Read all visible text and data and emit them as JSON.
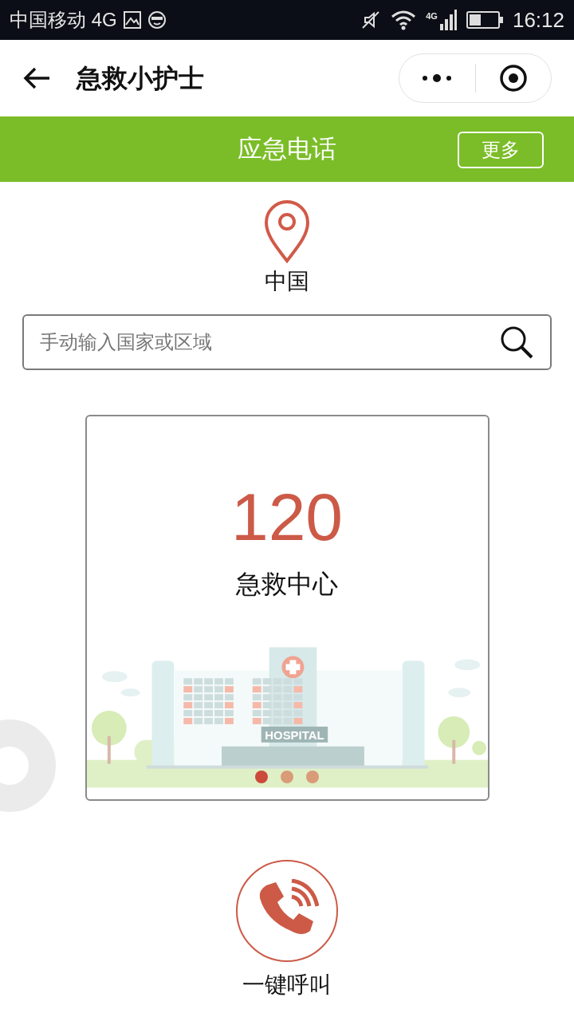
{
  "status_bar": {
    "carrier": "中国移动 4G",
    "network": "4G",
    "time": "16:12"
  },
  "nav_bar": {
    "title": "急救小护士"
  },
  "header": {
    "title": "应急电话",
    "more_button": "更多"
  },
  "location": {
    "name": "中国"
  },
  "search": {
    "placeholder": "手动输入国家或区域"
  },
  "card": {
    "number": "120",
    "label": "急救中心",
    "illustration_label": "HOSPITAL"
  },
  "carousel_dots": [
    {
      "selected": true
    },
    {
      "selected": false
    },
    {
      "selected": false
    }
  ],
  "call_button": {
    "label": "一键呼叫"
  }
}
